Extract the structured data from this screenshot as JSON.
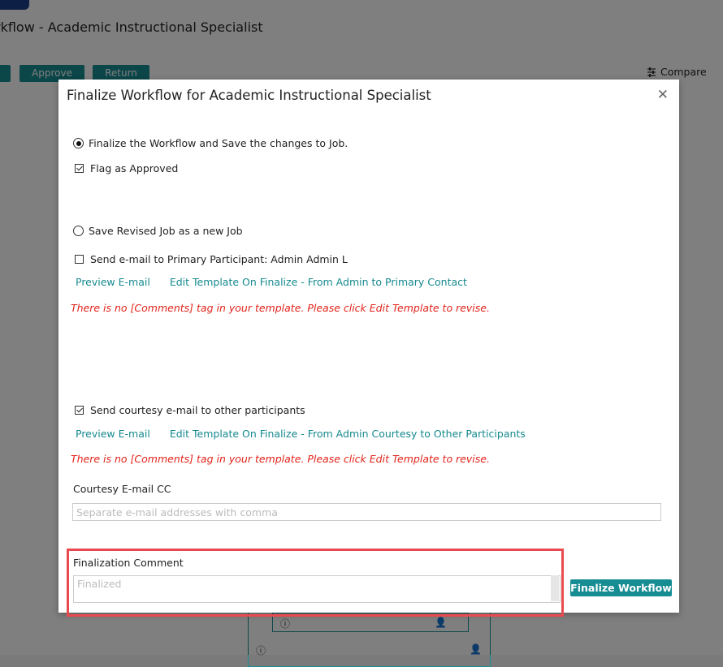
{
  "background": {
    "title": "rkflow - Academic Instructional Specialist",
    "approve_label": "Approve",
    "return_label": "Return",
    "compare_label": "Compare",
    "compare_icon": "compare-icon"
  },
  "modal": {
    "title": "Finalize Workflow for Academic Instructional Specialist",
    "close_glyph": "✕",
    "finalize_option": "Finalize the Workflow and Save the changes to Job.",
    "flag_approved": "Flag as Approved",
    "save_new_option": "Save Revised Job as a new Job",
    "send_primary": "Send e-mail to Primary Participant: Admin Admin L",
    "preview_email_1": "Preview E-mail",
    "edit_template_1": "Edit Template On Finalize - From Admin to Primary Contact",
    "warning_1": "There is no [Comments] tag in your template. Please click Edit Template to revise.",
    "send_courtesy": "Send courtesy e-mail to other participants",
    "preview_email_2": "Preview E-mail",
    "edit_template_2": "Edit Template On Finalize - From Admin Courtesy to Other Participants",
    "warning_2": "There is no [Comments] tag in your template. Please click Edit Template to revise.",
    "courtesy_cc_label": "Courtesy E-mail CC",
    "courtesy_cc_placeholder": "Separate e-mail addresses with comma",
    "finalization_comment_label": "Finalization Comment",
    "finalization_comment_value": "Finalized",
    "finalize_button": "Finalize Workflow"
  },
  "state": {
    "finalize_selected": true,
    "flag_approved_checked": true,
    "save_new_selected": false,
    "send_primary_checked": false,
    "send_courtesy_checked": true
  },
  "colors": {
    "accent": "#168c93",
    "warning": "#e2231a",
    "highlight": "#e94a4f"
  }
}
